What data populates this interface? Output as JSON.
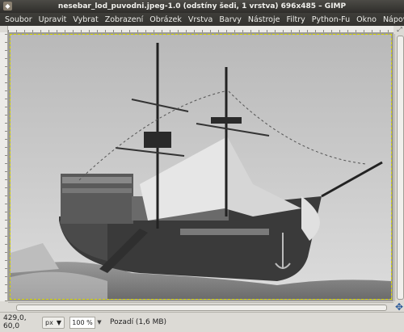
{
  "window": {
    "title": "nesebar_lod_puvodni.jpeg-1.0 (odstíny šedi, 1 vrstva) 696x485 – GIMP"
  },
  "menu": [
    "Soubor",
    "Upravit",
    "Vybrat",
    "Zobrazení",
    "Obrázek",
    "Vrstva",
    "Barvy",
    "Nástroje",
    "Filtry",
    "Python-Fu",
    "Okno",
    "Nápověda"
  ],
  "status": {
    "coords": "429,0, 60,0",
    "unit": "px",
    "zoom": "100 %",
    "layer": "Pozadí (1,6 MB)"
  },
  "icons": {
    "app": "gimp-icon",
    "navigate": "navigate-icon",
    "dropdown": "chevron-down-icon"
  },
  "colors": {
    "titlebar": "#2f2e2b",
    "menubar": "#3e3d39",
    "selection_border": "#d4d400",
    "navigate": "#2a5a9a"
  }
}
